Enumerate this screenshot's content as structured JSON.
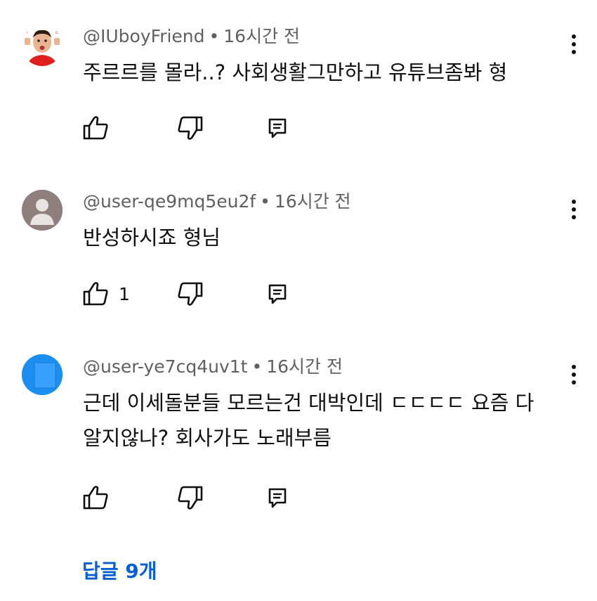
{
  "comments": [
    {
      "author": "@IUboyFriend",
      "separator": "•",
      "time": "16시간 전",
      "lines": [
        "주르르를 몰라..? 사회생활그만하고 유튜브좀봐 형"
      ],
      "likes": "",
      "avatar": "photo-avatar"
    },
    {
      "author": "@user-qe9mq5eu2f",
      "separator": "•",
      "time": "16시간 전",
      "lines": [
        "반성하시죠 형님"
      ],
      "likes": "1",
      "avatar": "default-person-avatar"
    },
    {
      "author": "@user-ye7cq4uv1t",
      "separator": "•",
      "time": "16시간 전",
      "lines": [
        "근데 이세돌분들 모르는건 대박인데 ㄷㄷㄷㄷ 요즘 다",
        "알지않나? 회사가도 노래부름"
      ],
      "likes": "",
      "avatar": "blue-square-avatar"
    }
  ],
  "replies_link": "답글 9개",
  "icons": {
    "like": "thumbs-up-icon",
    "dislike": "thumbs-down-icon",
    "reply": "reply-icon",
    "more": "more-vertical-icon"
  },
  "colors": {
    "text": "#0f0f0f",
    "meta": "#606060",
    "link": "#065fd4",
    "avatar_gray": "#8e7f7c",
    "avatar_blue": "#1a8ff0"
  }
}
